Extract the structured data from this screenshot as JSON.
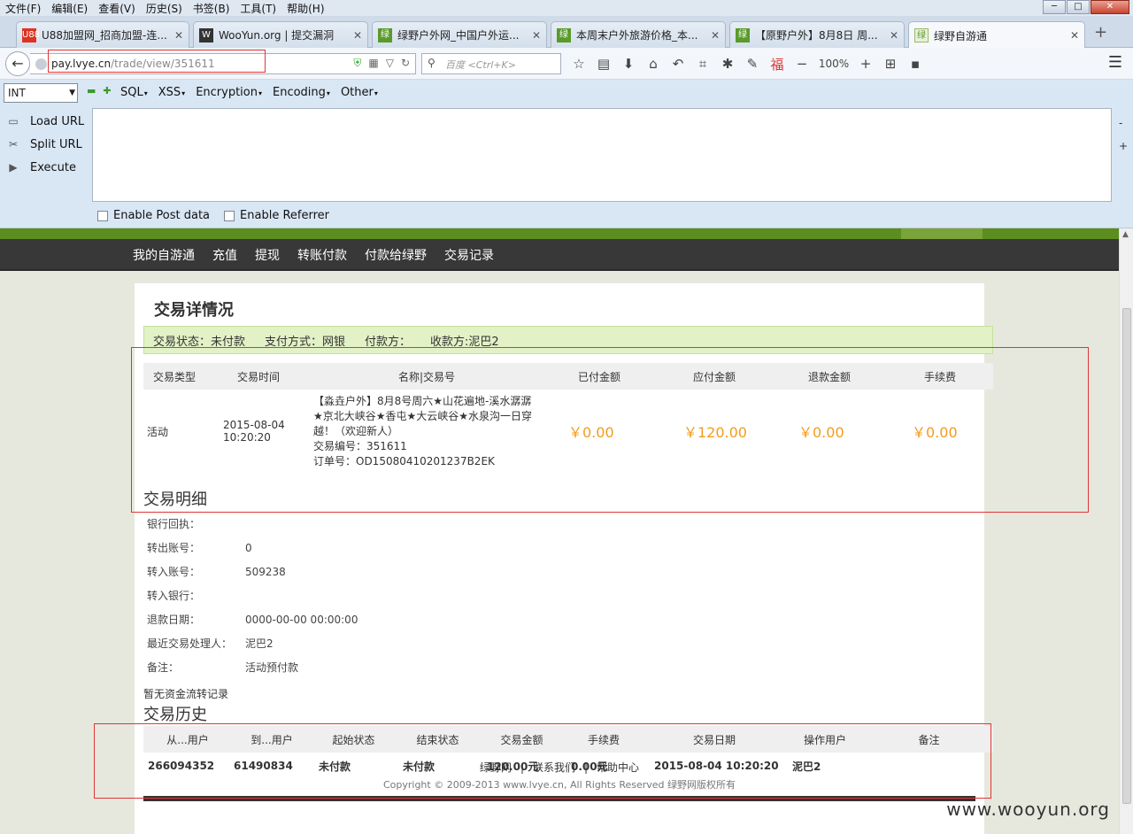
{
  "menubar": [
    "文件(F)",
    "编辑(E)",
    "查看(V)",
    "历史(S)",
    "书签(B)",
    "工具(T)",
    "帮助(H)"
  ],
  "tabs": [
    {
      "label": "U88加盟网_招商加盟-连...",
      "icon": "U88"
    },
    {
      "label": "WooYun.org | 提交漏洞",
      "icon": "W"
    },
    {
      "label": "绿野户外网_中国户外运...",
      "icon": "绿"
    },
    {
      "label": "本周末户外旅游价格_本...",
      "icon": "绿"
    },
    {
      "label": "【原野户外】8月8日 周...",
      "icon": "绿"
    },
    {
      "label": "绿野自游通",
      "icon": "绿"
    }
  ],
  "nav": {
    "url_host": "pay.lvye.cn",
    "url_path": "/trade/view/351611",
    "search_placeholder": "百度 <Ctrl+K>",
    "zoom": "100%"
  },
  "hackbar": {
    "select_value": "INT",
    "menus": [
      "SQL",
      "XSS",
      "Encryption",
      "Encoding",
      "Other"
    ],
    "actions": [
      "Load URL",
      "Split URL",
      "Execute"
    ],
    "enable_post": "Enable Post data",
    "enable_referrer": "Enable Referrer"
  },
  "site_nav": [
    "我的自游通",
    "充值",
    "提现",
    "转账付款",
    "付款给绿野",
    "交易记录"
  ],
  "page": {
    "title": "交易详情况",
    "status": {
      "trade_status": "交易状态：未付款",
      "pay_method": "支付方式：网银",
      "payer": "付款方：",
      "payee": "收款方:泥巴2"
    },
    "trade_headers": [
      "交易类型",
      "交易时间",
      "名称|交易号",
      "已付金额",
      "应付金额",
      "退款金额",
      "手续费"
    ],
    "trade_row": {
      "type": "活动",
      "time": "2015-08-04 10:20:20",
      "name": "【淼垚户外】8月8号周六★山花遍地-溪水潺潺★京北大峡谷★香屯★大云峡谷★水泉沟一日穿越！（欢迎新人）",
      "trade_no": "交易编号：351611",
      "order_no": "订单号：OD15080410201237B2EK",
      "paid": "￥0.00",
      "payable": "￥120.00",
      "refund": "￥0.00",
      "fee": "￥0.00"
    },
    "detail_title": "交易明细",
    "details": [
      {
        "k": "银行回执：",
        "v": ""
      },
      {
        "k": "转出账号：",
        "v": "0"
      },
      {
        "k": "转入账号：",
        "v": "509238"
      },
      {
        "k": "转入银行：",
        "v": ""
      },
      {
        "k": "退款日期：",
        "v": "0000-00-00 00:00:00"
      },
      {
        "k": "最近交易处理人：",
        "v": "泥巴2"
      },
      {
        "k": "备注：",
        "v": "活动预付款"
      }
    ],
    "no_flow": "暂无资金流转记录",
    "history_title": "交易历史",
    "history_headers": [
      "从...用户",
      "到...用户",
      "起始状态",
      "结束状态",
      "交易金额",
      "手续费",
      "交易日期",
      "操作用户",
      "备注"
    ],
    "history_rows": [
      [
        "266094352",
        "61490834",
        "未付款",
        "未付款",
        "120.00元",
        "0.00元",
        "2015-08-04 10:20:20",
        "泥巴2",
        ""
      ]
    ],
    "footer_links": [
      "绿野网",
      "联系我们",
      "帮助中心"
    ],
    "copyright": "Copyright © 2009-2013 www.lvye.cn, All Rights Reserved 绿野网版权所有",
    "watermark": "www.wooyun.org"
  }
}
